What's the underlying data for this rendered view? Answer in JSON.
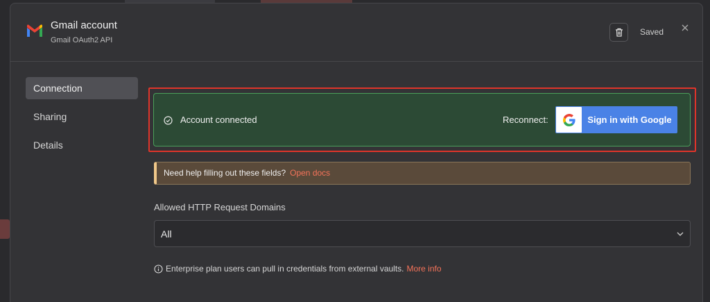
{
  "header": {
    "title": "Gmail account",
    "subtitle": "Gmail OAuth2 API",
    "saved_label": "Saved"
  },
  "sidebar": {
    "items": [
      {
        "label": "Connection",
        "active": true
      },
      {
        "label": "Sharing",
        "active": false
      },
      {
        "label": "Details",
        "active": false
      }
    ]
  },
  "connection": {
    "status_text": "Account connected",
    "reconnect_label": "Reconnect:",
    "google_button_label": "Sign in with Google"
  },
  "help": {
    "text": "Need help filling out these fields?",
    "link": "Open docs"
  },
  "domains": {
    "label": "Allowed HTTP Request Domains",
    "value": "All"
  },
  "enterprise": {
    "text": "Enterprise plan users can pull in credentials from external vaults.",
    "link": "More info"
  },
  "colors": {
    "accent": "#f5735a",
    "success_bg": "#2c4a35",
    "google_blue": "#4a82e6",
    "highlight_red": "#e0342a"
  },
  "icons": [
    "gmail-logo-icon",
    "trash-icon",
    "close-icon",
    "check-circle-icon",
    "google-g-icon",
    "chevron-down-icon",
    "info-icon"
  ]
}
